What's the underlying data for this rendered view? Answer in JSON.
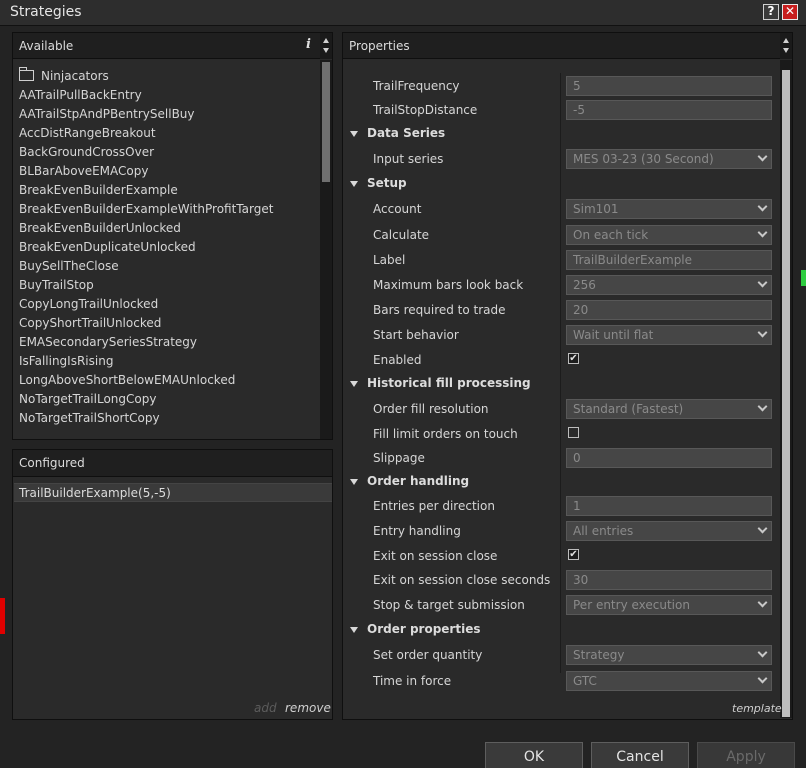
{
  "window": {
    "title": "Strategies",
    "help_glyph": "?",
    "close_glyph": "✕"
  },
  "available": {
    "header": "Available",
    "info_glyph": "i",
    "folder": "Ninjacators",
    "items": [
      "AATrailPullBackEntry",
      "AATrailStpAndPBentrySellBuy",
      "AccDistRangeBreakout",
      "BackGroundCrossOver",
      "BLBarAboveEMACopy",
      "BreakEvenBuilderExample",
      "BreakEvenBuilderExampleWithProfitTarget",
      "BreakEvenBuilderUnlocked",
      "BreakEvenDuplicateUnlocked",
      "BuySellTheClose",
      "BuyTrailStop",
      "CopyLongTrailUnlocked",
      "CopyShortTrailUnlocked",
      "EMASecondarySeriesStrategy",
      "IsFallingIsRising",
      "LongAboveShortBelowEMAUnlocked",
      "NoTargetTrailLongCopy",
      "NoTargetTrailShortCopy"
    ]
  },
  "configured": {
    "header": "Configured",
    "items": [
      "TrailBuilderExample(5,-5)"
    ],
    "add_label": "add",
    "remove_label": "remove"
  },
  "properties": {
    "header": "Properties",
    "trail_frequency": {
      "label": "TrailFrequency",
      "value": "5"
    },
    "trail_stop_distance": {
      "label": "TrailStopDistance",
      "value": "-5"
    },
    "data_series": {
      "category": "Data Series",
      "input_series": {
        "label": "Input series",
        "value": "MES 03-23 (30 Second)"
      }
    },
    "setup": {
      "category": "Setup",
      "account": {
        "label": "Account",
        "value": "Sim101"
      },
      "calculate": {
        "label": "Calculate",
        "value": "On each tick"
      },
      "label_field": {
        "label": "Label",
        "value": "TrailBuilderExample"
      },
      "max_bars": {
        "label": "Maximum bars look back",
        "value": "256"
      },
      "bars_required": {
        "label": "Bars required to trade",
        "value": "20"
      },
      "start_behavior": {
        "label": "Start behavior",
        "value": "Wait until flat"
      },
      "enabled": {
        "label": "Enabled",
        "checked": true
      }
    },
    "historical": {
      "category": "Historical fill processing",
      "order_fill_resolution": {
        "label": "Order fill resolution",
        "value": "Standard (Fastest)"
      },
      "fill_limit_on_touch": {
        "label": "Fill limit orders on touch",
        "checked": false
      },
      "slippage": {
        "label": "Slippage",
        "value": "0"
      }
    },
    "order_handling": {
      "category": "Order handling",
      "entries_per_direction": {
        "label": "Entries per direction",
        "value": "1"
      },
      "entry_handling": {
        "label": "Entry handling",
        "value": "All entries"
      },
      "exit_on_close": {
        "label": "Exit on session close",
        "checked": true
      },
      "exit_on_close_seconds": {
        "label": "Exit on session close seconds",
        "value": "30"
      },
      "stop_target_submission": {
        "label": "Stop & target submission",
        "value": "Per entry execution"
      }
    },
    "order_properties": {
      "category": "Order properties",
      "set_order_quantity": {
        "label": "Set order quantity",
        "value": "Strategy"
      },
      "time_in_force": {
        "label": "Time in force",
        "value": "GTC"
      }
    },
    "template_label": "template",
    "check_glyph": "✔"
  },
  "buttons": {
    "ok": "OK",
    "cancel": "Cancel",
    "apply": "Apply"
  }
}
